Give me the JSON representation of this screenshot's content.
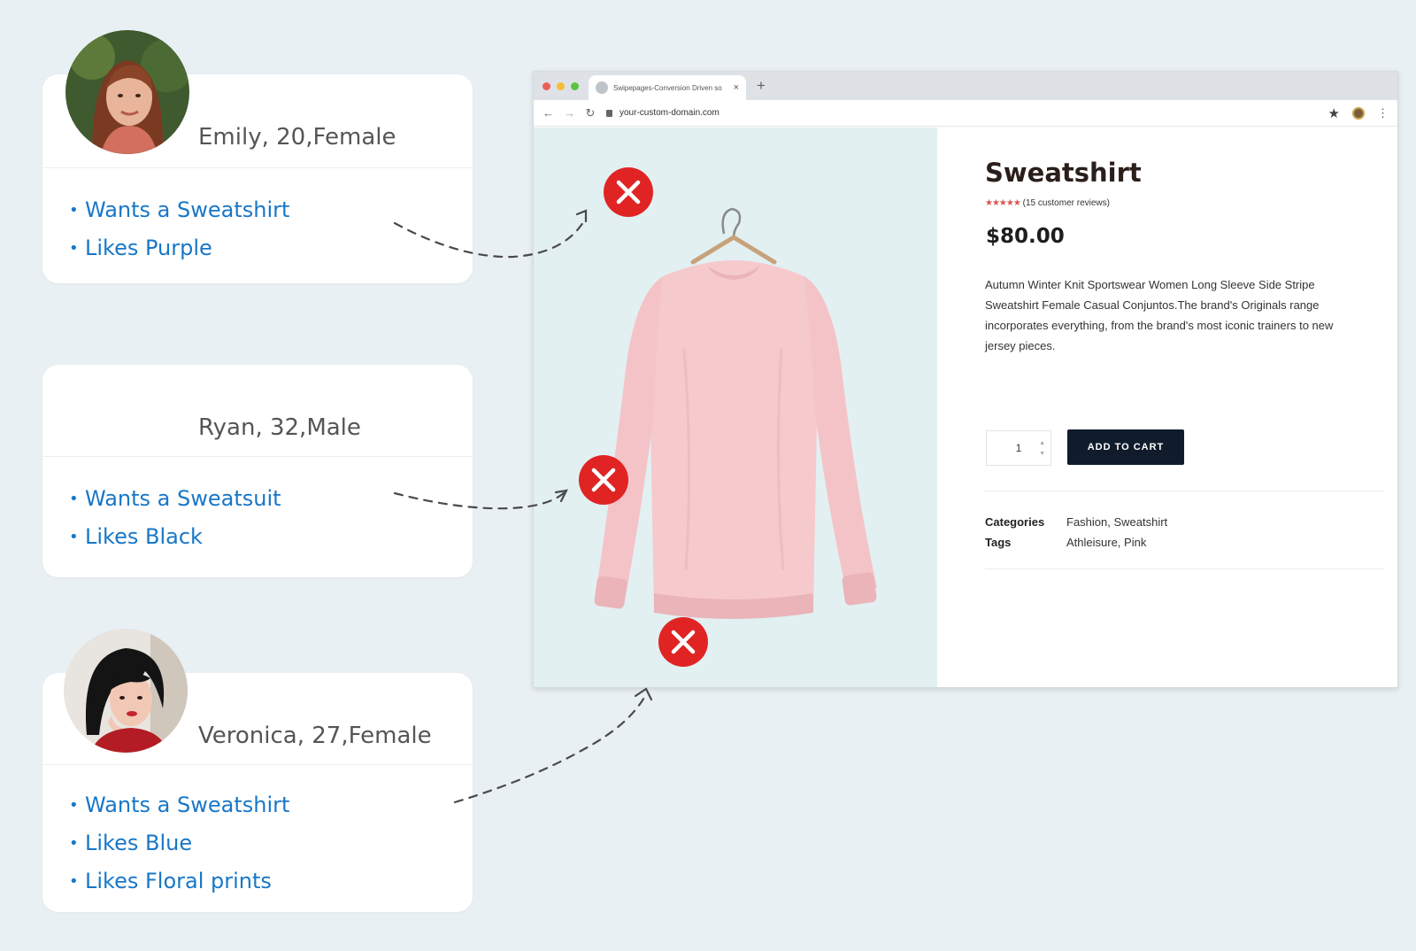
{
  "personas": [
    {
      "name": "Emily, 20,Female",
      "interests": [
        "Wants a Sweatshirt",
        "Likes Purple"
      ]
    },
    {
      "name": "Ryan, 32,Male",
      "interests": [
        "Wants a Sweatsuit",
        "Likes Black"
      ]
    },
    {
      "name": "Veronica, 27,Female",
      "interests": [
        "Wants a Sweatshirt",
        "Likes Blue",
        "Likes Floral prints"
      ]
    }
  ],
  "browser": {
    "tab_title": "Swipepages-Conversion Driven so",
    "url": "your-custom-domain.com"
  },
  "product": {
    "title": "Sweatshirt",
    "stars": "★★★★★",
    "rating_text": "(15 customer reviews)",
    "price": "$80.00",
    "description": "Autumn Winter Knit Sportswear Women Long Sleeve Side Stripe Sweatshirt Female Casual Conjuntos.The brand's Originals range incorporates everything, from the brand's most iconic trainers to new jersey pieces.",
    "quantity": "1",
    "add_to_cart": "ADD TO CART",
    "categories_label": "Categories",
    "categories_value": "Fashion, Sweatshirt",
    "tags_label": "Tags",
    "tags_value": "Athleisure, Pink"
  },
  "colors": {
    "background": "#e9f0f4",
    "interest_text": "#1877c8",
    "reject_mark": "#e02424",
    "cart_button": "#101c2c",
    "sweatshirt": "#f6c9cd"
  }
}
